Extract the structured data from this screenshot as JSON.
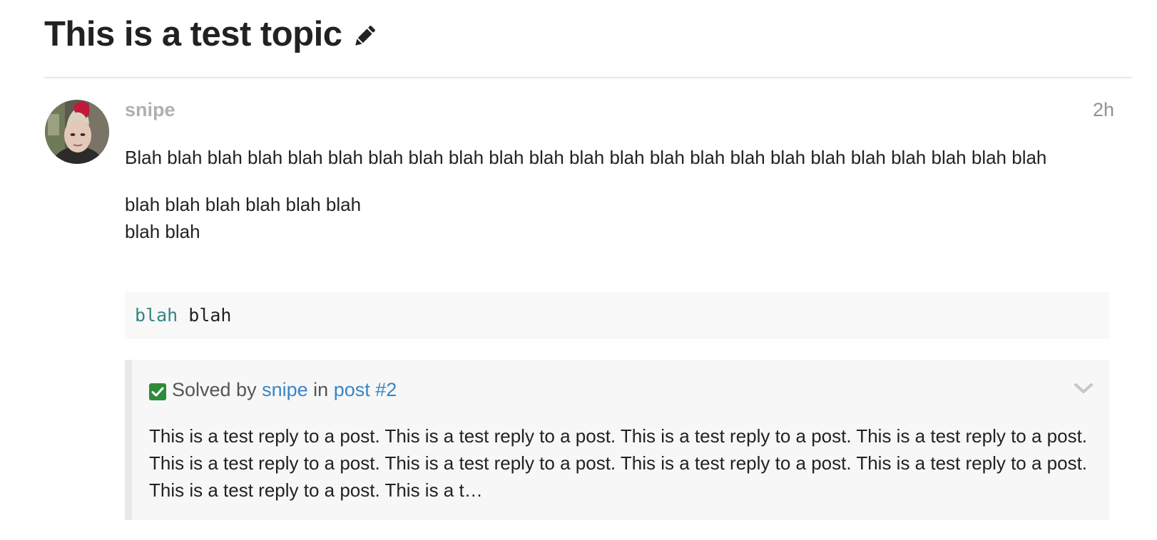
{
  "topic": {
    "title": "This is a test topic"
  },
  "post": {
    "username": "snipe",
    "date": "2h",
    "paragraph1": "Blah blah blah blah blah blah blah blah blah blah blah blah blah blah blah blah blah blah blah blah blah blah blah",
    "paragraph2_line1": "blah blah blah blah blah blah",
    "paragraph2_line2": "blah blah",
    "code": {
      "keyword": "blah",
      "rest": " blah"
    }
  },
  "accepted_answer": {
    "prefix": "Solved by",
    "user": "snipe",
    "mid": "in",
    "post_link": "post #2",
    "excerpt": "This is a test reply to a post. This is a test reply to a post. This is a test reply to a post. This is a test reply to a post. This is a test reply to a post. This is a test reply to a post. This is a test reply to a post. This is a test reply to a post. This is a test reply to a post. This is a t…"
  },
  "colors": {
    "link": "#3a85c6",
    "username": "#b0b0b0",
    "check": "#2e8b3a",
    "code_keyword": "#338484"
  },
  "icons": [
    "pencil-icon",
    "checkbox-check-icon",
    "chevron-down-icon"
  ]
}
